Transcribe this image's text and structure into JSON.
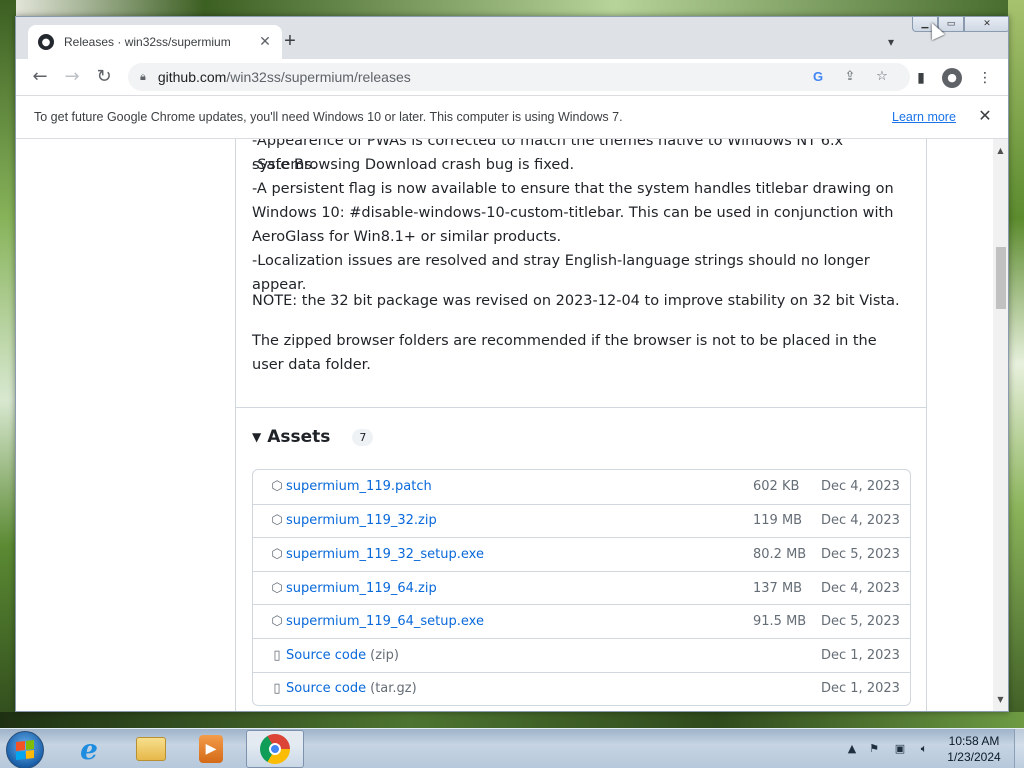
{
  "browser": {
    "tab_title": "Releases · win32ss/supermium",
    "new_tab_label": "+",
    "url_host": "github.com",
    "url_path": "/win32ss/supermium/releases"
  },
  "infobar": {
    "message": "To get future Google Chrome updates, you'll need Windows 10 or later. This computer is using Windows 7.",
    "link": "Learn more"
  },
  "release": {
    "lines": [
      "-Appearence of PWAs is corrected to match the themes native to Windows NT 6.x systems.",
      "-Safe Browsing Download crash bug is fixed.",
      "-A persistent flag is now available to ensure that the system handles titlebar drawing on Windows 10: #disable-windows-10-custom-titlebar. This can be used in conjunction with AeroGlass for Win8.1+ or similar products.",
      "-Localization issues are resolved and stray English-language strings should no longer appear."
    ],
    "note": "NOTE: the 32 bit package was revised on 2023-12-04 to improve stability on 32 bit Vista.",
    "zipped_note": "The zipped browser folders are recommended if the browser is not to be placed in the user data folder."
  },
  "assets": {
    "title": "Assets",
    "count": "7",
    "items": [
      {
        "name": "supermium_119.patch",
        "ext": "",
        "size": "602 KB",
        "date": "Dec 4, 2023",
        "icon": "package-icon"
      },
      {
        "name": "supermium_119_32.zip",
        "ext": "",
        "size": "119 MB",
        "date": "Dec 4, 2023",
        "icon": "package-icon"
      },
      {
        "name": "supermium_119_32_setup.exe",
        "ext": "",
        "size": "80.2 MB",
        "date": "Dec 5, 2023",
        "icon": "package-icon"
      },
      {
        "name": "supermium_119_64.zip",
        "ext": "",
        "size": "137 MB",
        "date": "Dec 4, 2023",
        "icon": "package-icon"
      },
      {
        "name": "supermium_119_64_setup.exe",
        "ext": "",
        "size": "91.5 MB",
        "date": "Dec 5, 2023",
        "icon": "package-icon"
      },
      {
        "name": "Source code",
        "ext": "(zip)",
        "size": "",
        "date": "Dec 1, 2023",
        "icon": "file-zip-icon"
      },
      {
        "name": "Source code",
        "ext": "(tar.gz)",
        "size": "",
        "date": "Dec 1, 2023",
        "icon": "file-zip-icon"
      }
    ]
  },
  "taskbar": {
    "time": "10:58 AM",
    "date": "1/23/2024"
  },
  "colors": {
    "link": "#0969da",
    "chrome_link": "#1a73e8",
    "text": "#1f2328",
    "muted": "#656d76"
  }
}
